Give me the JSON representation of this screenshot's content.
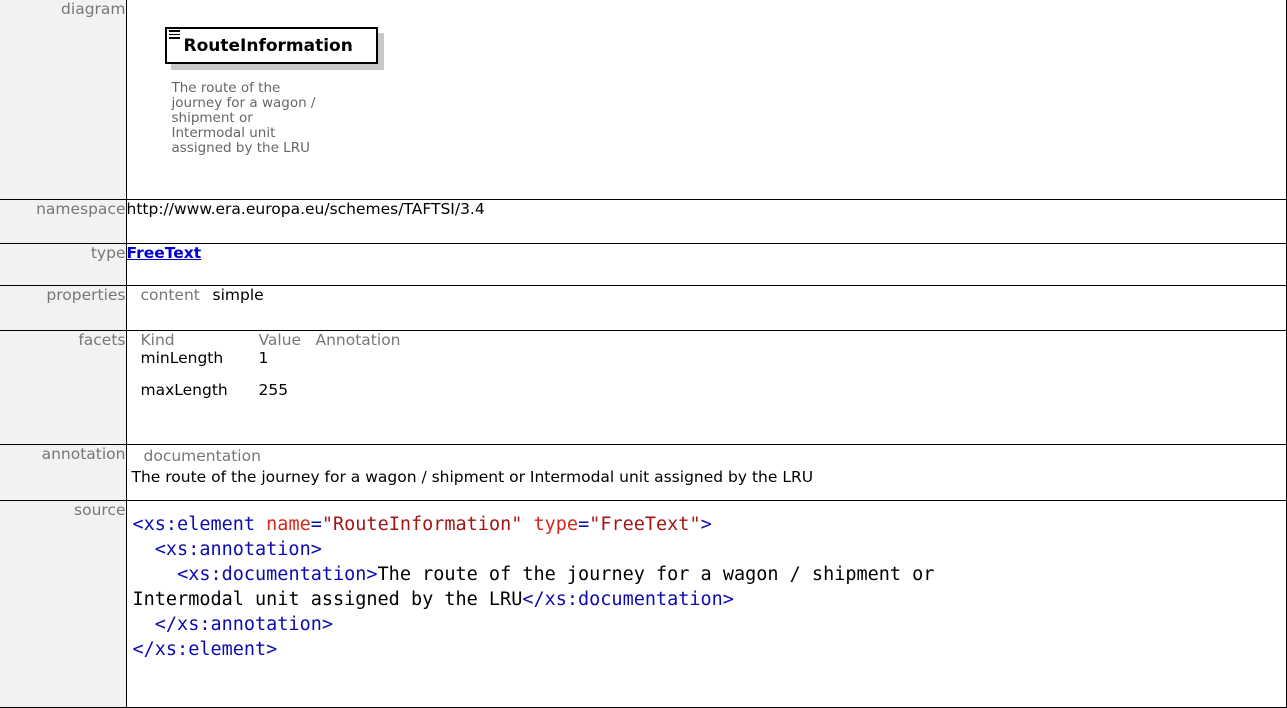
{
  "rows": {
    "diagram": {
      "label": "diagram",
      "node_title": "RouteInformation",
      "node_desc": "The route of the journey for a wagon / shipment or Intermodal unit assigned by the LRU",
      "node_icon": "element-list-icon"
    },
    "namespace": {
      "label": "namespace",
      "value": "http://www.era.europa.eu/schemes/TAFTSI/3.4"
    },
    "type": {
      "label": "type",
      "value": "FreeText"
    },
    "properties": {
      "label": "properties",
      "key": "content",
      "value": "simple"
    },
    "facets": {
      "label": "facets",
      "headers": [
        "Kind",
        "Value",
        "Annotation"
      ],
      "items": [
        {
          "kind": "minLength",
          "value": "1",
          "annotation": ""
        },
        {
          "kind": "maxLength",
          "value": "255",
          "annotation": ""
        }
      ]
    },
    "annotation": {
      "label": "annotation",
      "heading": "documentation",
      "text": "The route of the journey for a wagon / shipment or Intermodal unit assigned by the LRU"
    },
    "source": {
      "label": "source",
      "line1_open": "<xs:element",
      "line1_attr1": "name",
      "line1_val1": "\"RouteInformation\"",
      "line1_attr2": "type",
      "line1_val2": "\"FreeText\"",
      "line1_close": ">",
      "line2": "<xs:annotation>",
      "line3_open": "<xs:documentation>",
      "line3_text": "The route of the journey for a wagon / shipment or",
      "line4_text": "Intermodal unit assigned by the LRU",
      "line4_close": "</xs:documentation>",
      "line5": "</xs:annotation>",
      "line6": "</xs:element>"
    }
  }
}
